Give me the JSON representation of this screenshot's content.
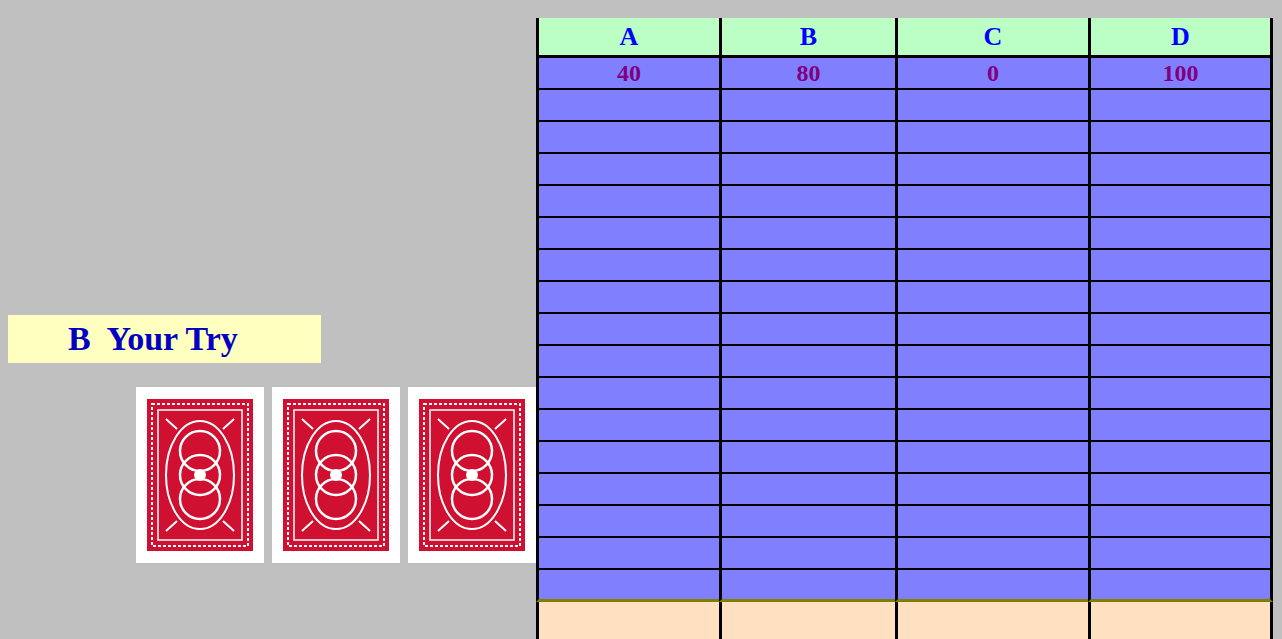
{
  "prompt": {
    "label": "B  Your Try"
  },
  "cards": [
    {
      "face_down": true
    },
    {
      "face_down": true
    },
    {
      "face_down": true
    }
  ],
  "table": {
    "columns": [
      {
        "label": "A"
      },
      {
        "label": "B"
      },
      {
        "label": "C"
      },
      {
        "label": "D"
      }
    ],
    "rows": [
      {
        "cells": [
          "40",
          "80",
          "0",
          "100"
        ]
      },
      {
        "cells": [
          "",
          "",
          "",
          ""
        ]
      },
      {
        "cells": [
          "",
          "",
          "",
          ""
        ]
      },
      {
        "cells": [
          "",
          "",
          "",
          ""
        ]
      },
      {
        "cells": [
          "",
          "",
          "",
          ""
        ]
      },
      {
        "cells": [
          "",
          "",
          "",
          ""
        ]
      },
      {
        "cells": [
          "",
          "",
          "",
          ""
        ]
      },
      {
        "cells": [
          "",
          "",
          "",
          ""
        ]
      },
      {
        "cells": [
          "",
          "",
          "",
          ""
        ]
      },
      {
        "cells": [
          "",
          "",
          "",
          ""
        ]
      },
      {
        "cells": [
          "",
          "",
          "",
          ""
        ]
      },
      {
        "cells": [
          "",
          "",
          "",
          ""
        ]
      },
      {
        "cells": [
          "",
          "",
          "",
          ""
        ]
      },
      {
        "cells": [
          "",
          "",
          "",
          ""
        ]
      },
      {
        "cells": [
          "",
          "",
          "",
          ""
        ]
      },
      {
        "cells": [
          "",
          "",
          "",
          ""
        ]
      },
      {
        "cells": [
          "",
          "",
          "",
          ""
        ]
      }
    ],
    "footer": {
      "cells": [
        "",
        "",
        "",
        ""
      ]
    }
  }
}
